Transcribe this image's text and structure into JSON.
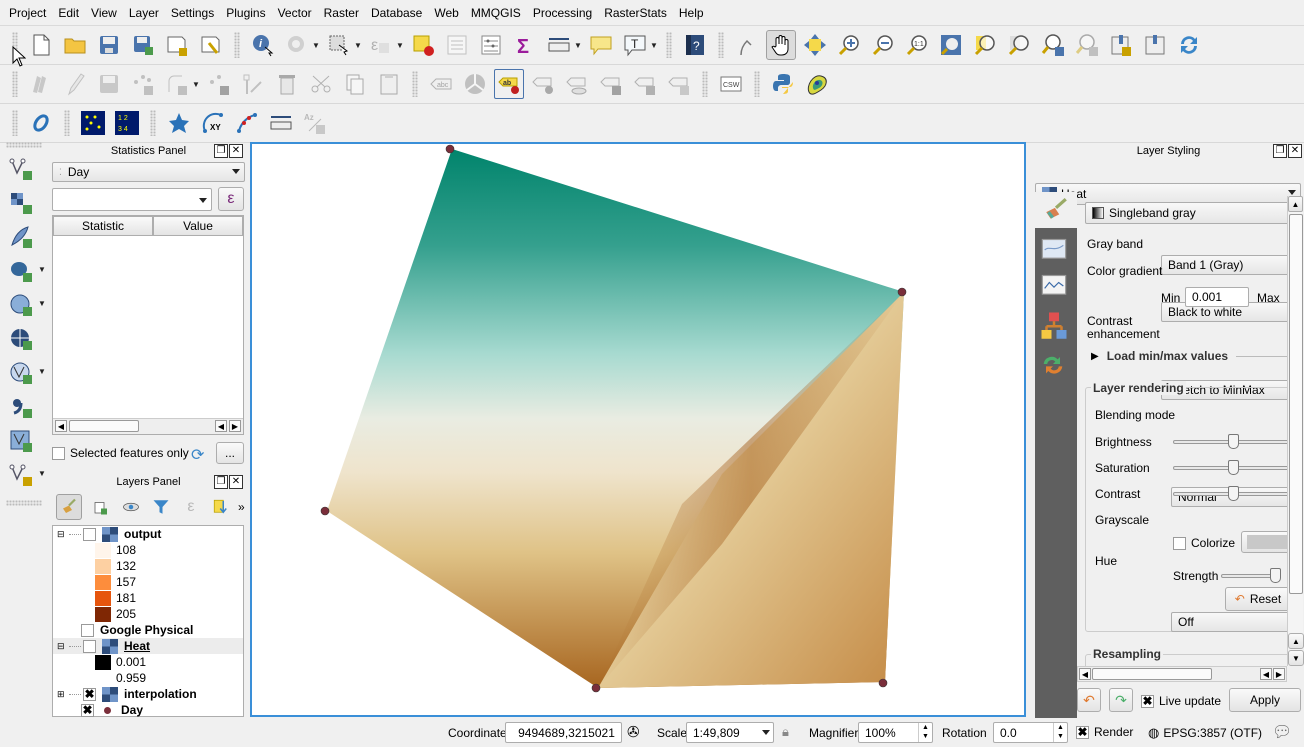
{
  "menu": [
    "Project",
    "Edit",
    "View",
    "Layer",
    "Settings",
    "Plugins",
    "Vector",
    "Raster",
    "Database",
    "Web",
    "MMQGIS",
    "Processing",
    "RasterStats",
    "Help"
  ],
  "toolbar1": [
    "new-project-icon",
    "open-project-icon",
    "save-project-icon",
    "save-as-icon",
    "new-print-layout-icon",
    "layout-manager-icon",
    "identify-icon",
    "run-action-icon",
    "select-features-icon",
    "select-by-expression-icon",
    "deselect-all-icon",
    "attribute-table-icon",
    "field-calculator-icon",
    "statistics-sum-icon",
    "measure-icon",
    "map-tips-icon",
    "text-annotation-icon",
    "help-icon",
    "touch-zoom-icon",
    "pan-icon",
    "pan-to-selection-icon",
    "zoom-in-icon",
    "zoom-out-icon",
    "zoom-native-icon",
    "zoom-full-icon",
    "zoom-to-selection-icon",
    "zoom-to-layer-icon",
    "zoom-last-icon",
    "zoom-next-icon",
    "new-bookmark-icon",
    "show-bookmarks-icon",
    "refresh-icon"
  ],
  "toolbar2": [
    "current-edits-icon",
    "toggle-editing-icon",
    "save-edits-icon",
    "add-feature-icon",
    "add-circular-string-icon",
    "move-feature-icon",
    "node-tool-icon",
    "delete-selected-icon",
    "cut-features-icon",
    "copy-features-icon",
    "paste-features-icon",
    "layer-labeling-icon",
    "layer-diagram-icon",
    "highlight-pinned-labels-icon",
    "pin-labels-icon",
    "show-hide-labels-icon",
    "move-label-icon",
    "rotate-label-icon",
    "change-label-icon",
    "csw-icon",
    "python-console-icon",
    "heatmap-plugin-icon"
  ],
  "toolbar3": [
    "ring-icon",
    "points-grid-icon",
    "numbered-points-grid-icon",
    "star-shape-icon",
    "xy-arc-icon",
    "polyline-points-icon",
    "ruler-icon",
    "azimuth-distance-icon"
  ],
  "left_toolbar": [
    "add-vector-layer-icon",
    "add-raster-layer-icon",
    "add-delimited-text-icon",
    "add-postgis-layer-icon",
    "add-wms-layer-icon",
    "add-wcs-layer-icon",
    "add-wfs-layer-icon",
    "add-spatialite-icon",
    "add-virtual-layer-icon",
    "new-shapefile-icon"
  ],
  "statistics_panel": {
    "title": "Statistics Panel",
    "layer": "Day",
    "field_value": "",
    "columns": [
      "Statistic",
      "Value"
    ],
    "selected_only_label": "Selected features only",
    "selected_only_checked": false,
    "more_button": "..."
  },
  "layers_panel": {
    "title": "Layers Panel",
    "layers": [
      {
        "name": "output",
        "expanded": true,
        "checked": false,
        "type": "raster",
        "legend": [
          {
            "label": "108",
            "color": "#fff5eb"
          },
          {
            "label": "132",
            "color": "#fdd0a2"
          },
          {
            "label": "157",
            "color": "#fd8d3c"
          },
          {
            "label": "181",
            "color": "#e6550d"
          },
          {
            "label": "205",
            "color": "#7f2704"
          }
        ]
      },
      {
        "name": "Google Physical",
        "checked": false,
        "type": "web"
      },
      {
        "name": "Heat",
        "expanded": true,
        "checked": false,
        "type": "raster",
        "selected": true,
        "legend": [
          {
            "label": "0.001",
            "color": "#000000"
          },
          {
            "label": "0.959",
            "color": "#ffffff"
          }
        ]
      },
      {
        "name": "interpolation",
        "expanded": false,
        "checked": true,
        "type": "raster"
      },
      {
        "name": "Day",
        "checked": true,
        "type": "point",
        "color": "#7a2e3a"
      }
    ]
  },
  "layer_styling": {
    "title": "Layer Styling",
    "layer": "Heat",
    "renderer": "Singleband gray",
    "gray_band_label": "Gray band",
    "gray_band": "Band 1 (Gray)",
    "color_gradient_label": "Color gradient",
    "color_gradient": "Black to white",
    "min_label": "Min",
    "min_value": "0.001",
    "max_label": "Max",
    "contrast_label_1": "Contrast",
    "contrast_label_2": "enhancement",
    "contrast": "Stretch to MinMax",
    "load_minmax": "Load min/max values",
    "rendering_title": "Layer rendering",
    "blending_label": "Blending mode",
    "blending": "Normal",
    "brightness_label": "Brightness",
    "brightness_value": 0.5,
    "saturation_label": "Saturation",
    "saturation_value": 0.5,
    "contrast_slider_label": "Contrast",
    "contrast_value": 0.5,
    "grayscale_label": "Grayscale",
    "grayscale": "Off",
    "hue_label": "Hue",
    "colorize_label": "Colorize",
    "colorize_checked": false,
    "strength_label": "Strength",
    "strength_value": 1.0,
    "reset_label": "Reset",
    "resampling_title": "Resampling",
    "live_update_label": "Live update",
    "live_update_checked": true,
    "apply_label": "Apply"
  },
  "map": {
    "points": [
      [
        450,
        149
      ],
      [
        902,
        292
      ],
      [
        325,
        511
      ],
      [
        596,
        688
      ],
      [
        883,
        683
      ]
    ],
    "point_color": "#7a2e3a"
  },
  "statusbar": {
    "coordinate_label": "Coordinate",
    "coordinate": "9494689,3215021",
    "scale_label": "Scale",
    "scale": "1:49,809",
    "magnifier_label": "Magnifier",
    "magnifier": "100%",
    "rotation_label": "Rotation",
    "rotation": "0.0",
    "render_label": "Render",
    "render_checked": true,
    "crs": "EPSG:3857 (OTF)"
  }
}
